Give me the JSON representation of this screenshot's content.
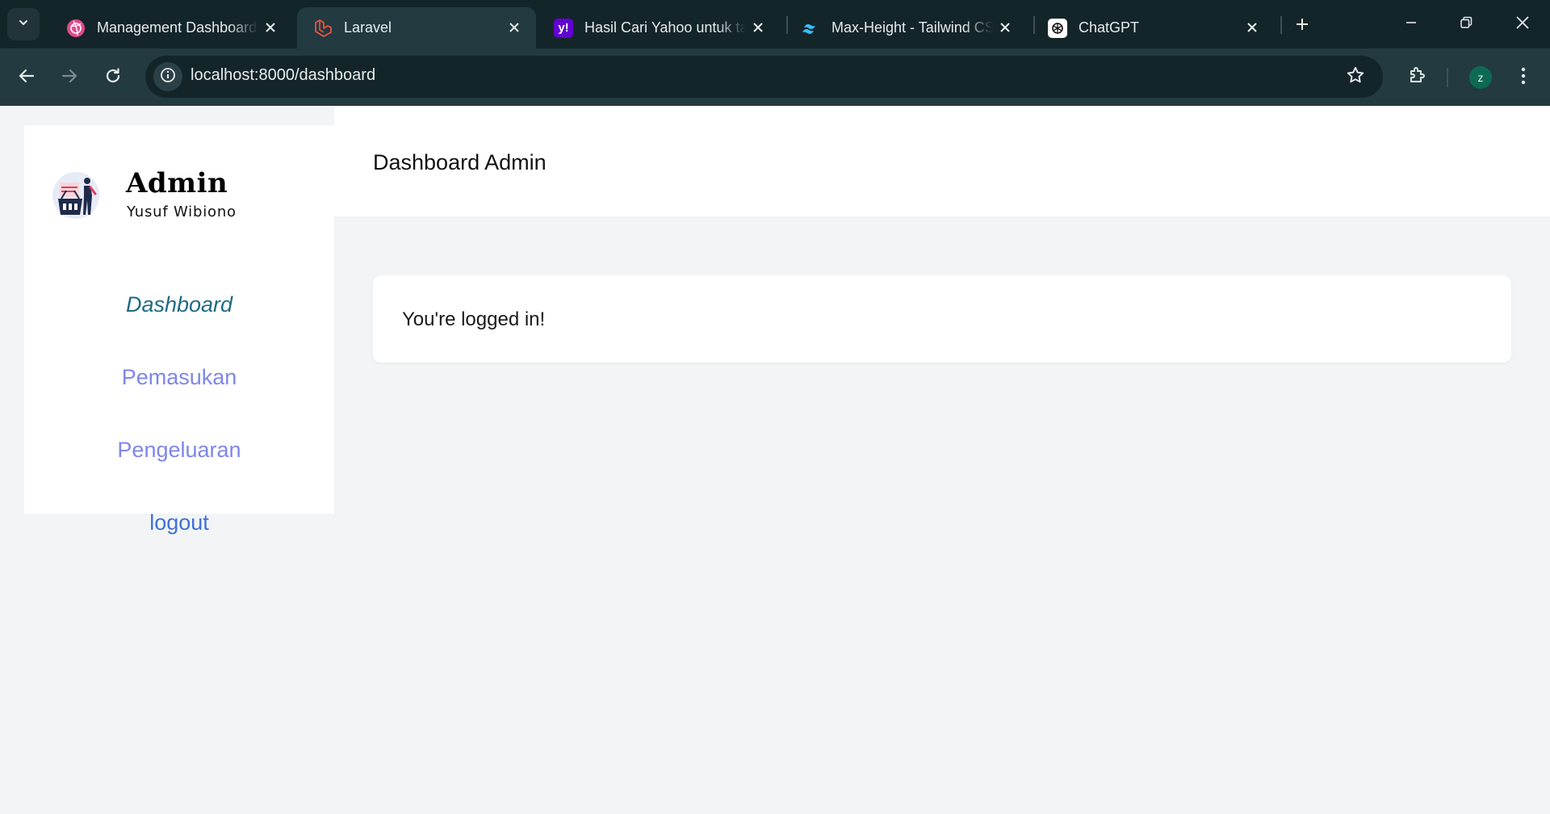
{
  "browser": {
    "tabs": [
      {
        "title": "Management Dashboard",
        "favicon": "dribbble-icon",
        "color": "#e24a8d"
      },
      {
        "title": "Laravel",
        "favicon": "laravel-icon",
        "color": "#f05340"
      },
      {
        "title": "Hasil Cari Yahoo untuk ta",
        "favicon": "yahoo-icon",
        "color": "#6001d2"
      },
      {
        "title": "Max-Height - Tailwind CSS",
        "favicon": "tailwind-icon",
        "color": "#38bdf8"
      },
      {
        "title": "ChatGPT",
        "favicon": "chatgpt-icon",
        "color": "#ffffff"
      }
    ],
    "active_tab": 1,
    "url": "localhost:8000/dashboard",
    "profile_initial": "z"
  },
  "sidebar": {
    "title": "Admin",
    "subtitle": "Yusuf Wibiono",
    "items": [
      {
        "label": "Dashboard",
        "active": true
      },
      {
        "label": "Pemasukan",
        "active": false
      },
      {
        "label": "Pengeluaran",
        "active": false
      },
      {
        "label": "logout",
        "active": false
      }
    ]
  },
  "header": {
    "title": "Dashboard Admin"
  },
  "main": {
    "message": "You're logged in!"
  },
  "colors": {
    "chrome_dark": "#14252a",
    "chrome_toolbar": "#233a40",
    "nav_active": "#1e6b86",
    "nav_link": "#7f86ea",
    "logout_link": "#3f71d6"
  }
}
